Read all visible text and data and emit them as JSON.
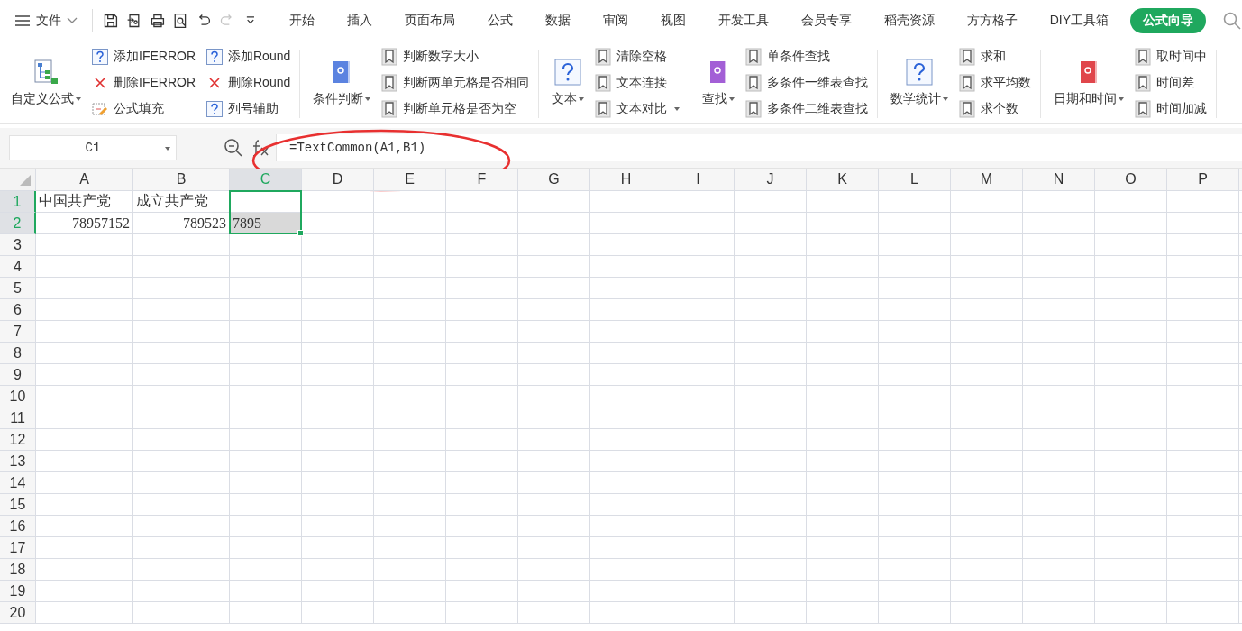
{
  "menu_bar": {
    "file_label": "文件",
    "quick_tools": [
      {
        "kind": "save",
        "disabled": false
      },
      {
        "kind": "export",
        "disabled": false
      },
      {
        "kind": "print",
        "disabled": false
      },
      {
        "kind": "preview",
        "disabled": false
      },
      {
        "kind": "undo",
        "disabled": false
      },
      {
        "kind": "redo",
        "disabled": true
      },
      {
        "kind": "more",
        "disabled": false
      }
    ],
    "tabs": [
      {
        "label": "开始",
        "selected": false
      },
      {
        "label": "插入",
        "selected": false
      },
      {
        "label": "页面布局",
        "selected": false
      },
      {
        "label": "公式",
        "selected": false
      },
      {
        "label": "数据",
        "selected": false
      },
      {
        "label": "审阅",
        "selected": false
      },
      {
        "label": "视图",
        "selected": false
      },
      {
        "label": "开发工具",
        "selected": false
      },
      {
        "label": "会员专享",
        "selected": false
      },
      {
        "label": "稻壳资源",
        "selected": false
      },
      {
        "label": "方方格子",
        "selected": false
      },
      {
        "label": "DIY工具箱",
        "selected": false
      },
      {
        "label": "公式向导",
        "selected": true
      }
    ]
  },
  "ribbon": {
    "groups": [
      {
        "big": {
          "label": "自定义公式",
          "kind": "tree",
          "dropdown": true
        },
        "columns": [
          [
            {
              "label": "添加IFERROR",
              "kind": "help",
              "dropdown": false
            },
            {
              "label": "删除IFERROR",
              "kind": "delete",
              "dropdown": false
            },
            {
              "label": "公式填充",
              "kind": "fill",
              "dropdown": false
            }
          ],
          [
            {
              "label": "添加Round",
              "kind": "help",
              "dropdown": false
            },
            {
              "label": "删除Round",
              "kind": "delete",
              "dropdown": false
            },
            {
              "label": "列号辅助",
              "kind": "help",
              "dropdown": false
            }
          ]
        ]
      },
      {
        "big": {
          "label": "条件判断",
          "kind": "book",
          "color": "#5b83e0",
          "dropdown": true
        },
        "columns": [
          [
            {
              "label": "判断数字大小",
              "kind": "bookmark",
              "dropdown": false
            },
            {
              "label": "判断两单元格是否相同",
              "kind": "bookmark",
              "dropdown": false
            },
            {
              "label": "判断单元格是否为空",
              "kind": "bookmark",
              "dropdown": false
            }
          ]
        ]
      },
      {
        "big": {
          "label": "文本",
          "kind": "help",
          "dropdown": true
        },
        "columns": [
          [
            {
              "label": "清除空格",
              "kind": "bookmark",
              "dropdown": false
            },
            {
              "label": "文本连接",
              "kind": "bookmark",
              "dropdown": false
            },
            {
              "label": "文本对比",
              "kind": "bookmark",
              "dropdown": true
            }
          ]
        ]
      },
      {
        "big": {
          "label": "查找",
          "kind": "book",
          "color": "#a35fd6",
          "dropdown": true
        },
        "columns": [
          [
            {
              "label": "单条件查找",
              "kind": "bookmark",
              "dropdown": false
            },
            {
              "label": "多条件一维表查找",
              "kind": "bookmark",
              "dropdown": false
            },
            {
              "label": "多条件二维表查找",
              "kind": "bookmark",
              "dropdown": false
            }
          ]
        ]
      },
      {
        "big": {
          "label": "数学统计",
          "kind": "help",
          "dropdown": true
        },
        "columns": [
          [
            {
              "label": "求和",
              "kind": "bookmark",
              "dropdown": false
            },
            {
              "label": "求平均数",
              "kind": "bookmark",
              "dropdown": false
            },
            {
              "label": "求个数",
              "kind": "bookmark",
              "dropdown": false
            }
          ]
        ]
      },
      {
        "big": {
          "label": "日期和时间",
          "kind": "book",
          "color": "#e0464b",
          "dropdown": true
        },
        "columns": [
          [
            {
              "label": "取时间中",
              "kind": "bookmark",
              "dropdown": false
            },
            {
              "label": "时间差",
              "kind": "bookmark",
              "dropdown": false
            },
            {
              "label": "时间加减",
              "kind": "bookmark",
              "dropdown": false
            }
          ]
        ]
      }
    ]
  },
  "formula_bar": {
    "name_box": "C1",
    "formula": "=TextCommon(A1,B1)"
  },
  "sheet": {
    "columns": [
      {
        "label": "A",
        "selected": false
      },
      {
        "label": "B",
        "selected": false
      },
      {
        "label": "C",
        "selected": true
      },
      {
        "label": "D",
        "selected": false
      },
      {
        "label": "E",
        "selected": false
      },
      {
        "label": "F",
        "selected": false
      },
      {
        "label": "G",
        "selected": false
      },
      {
        "label": "H",
        "selected": false
      },
      {
        "label": "I",
        "selected": false
      },
      {
        "label": "J",
        "selected": false
      },
      {
        "label": "K",
        "selected": false
      },
      {
        "label": "L",
        "selected": false
      },
      {
        "label": "M",
        "selected": false
      },
      {
        "label": "N",
        "selected": false
      },
      {
        "label": "O",
        "selected": false
      },
      {
        "label": "P",
        "selected": false
      }
    ],
    "rows": [
      {
        "label": "1",
        "selected": true,
        "cells": [
          {
            "text": "中国共产党",
            "kind": "text",
            "selected": false,
            "shaded": false
          },
          {
            "text": "成立共产党",
            "kind": "text",
            "selected": false,
            "shaded": false
          },
          {
            "selected": true,
            "shaded": false
          }
        ]
      },
      {
        "label": "2",
        "selected": true,
        "cells": [
          {
            "text": "78957152",
            "kind": "number",
            "selected": false,
            "shaded": false
          },
          {
            "text": "789523",
            "kind": "number",
            "selected": false,
            "shaded": false
          },
          {
            "text": "7895",
            "kind": "text",
            "selected": true,
            "shaded": true
          }
        ]
      },
      {
        "label": "3",
        "selected": false
      },
      {
        "label": "4",
        "selected": false
      },
      {
        "label": "5",
        "selected": false
      },
      {
        "label": "6",
        "selected": false
      },
      {
        "label": "7",
        "selected": false
      },
      {
        "label": "8",
        "selected": false
      },
      {
        "label": "9",
        "selected": false
      },
      {
        "label": "10",
        "selected": false
      },
      {
        "label": "11",
        "selected": false
      },
      {
        "label": "12",
        "selected": false
      },
      {
        "label": "13",
        "selected": false
      },
      {
        "label": "14",
        "selected": false
      },
      {
        "label": "15",
        "selected": false
      },
      {
        "label": "16",
        "selected": false
      },
      {
        "label": "17",
        "selected": false
      },
      {
        "label": "18",
        "selected": false
      },
      {
        "label": "19",
        "selected": false
      },
      {
        "label": "20",
        "selected": false
      }
    ]
  }
}
